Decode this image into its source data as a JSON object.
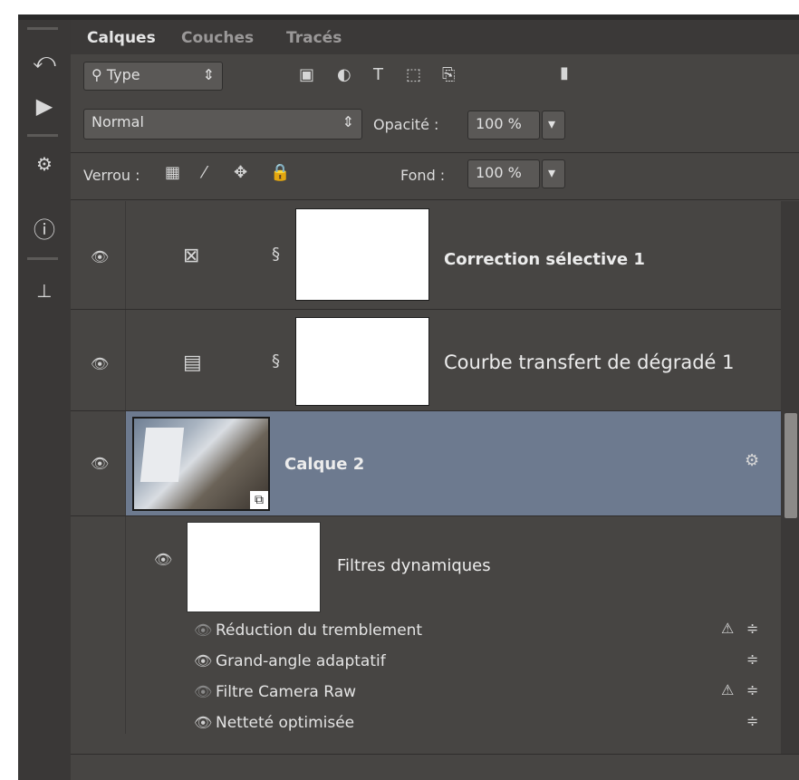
{
  "tabs": [
    "Calques",
    "Couches",
    "Tracés"
  ],
  "filter": {
    "label": "Type"
  },
  "blend": {
    "mode": "Normal",
    "opacity_label": "Opacité :",
    "opacity_value": "100 %"
  },
  "lock": {
    "label": "Verrou :",
    "fill_label": "Fond :",
    "fill_value": "100 %"
  },
  "layers": [
    {
      "name": "Correction sélective 1"
    },
    {
      "name": "Courbe transfert de dégradé 1"
    },
    {
      "name": "Calque 2"
    }
  ],
  "smart_filters": {
    "title": "Filtres dynamiques",
    "items": [
      "Réduction du tremblement",
      "Grand-angle adaptatif",
      "Filtre Camera Raw",
      "Netteté optimisée"
    ]
  },
  "colors": {
    "panel": "#474543",
    "selected": "#6d7a8f",
    "toolstrip": "#3a3837"
  }
}
